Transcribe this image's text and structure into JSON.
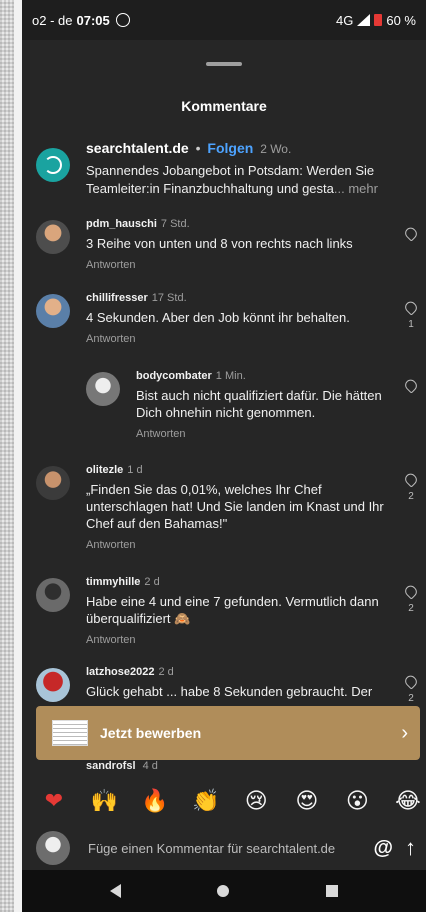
{
  "status_bar": {
    "carrier": "o2 - de",
    "time": "07:05",
    "network": "4G",
    "battery": "60 %"
  },
  "sheet": {
    "title": "Kommentare"
  },
  "caption": {
    "handle": "searchtalent.de",
    "separator": "•",
    "follow_label": "Folgen",
    "age": "2 Wo.",
    "text": "Spannendes Jobangebot in Potsdam: Werden Sie Teamleiter:in Finanzbuchhaltung und gesta",
    "more": "... mehr"
  },
  "comments": [
    {
      "user": "pdm_hauschi",
      "ago": "7 Std.",
      "text": "3 Reihe von unten und 8 von rechts nach links",
      "reply": "Antworten",
      "likes": ""
    },
    {
      "user": "chillifresser",
      "ago": "17 Std.",
      "text": "4 Sekunden. Aber den Job könnt ihr behalten.",
      "reply": "Antworten",
      "likes": "1"
    },
    {
      "user": "bodycombater",
      "ago": "1 Min.",
      "text": "Bist auch nicht qualifiziert dafür. Die hätten Dich ohnehin nicht genommen.",
      "reply": "Antworten",
      "likes": ""
    },
    {
      "user": "olitezle",
      "ago": "1 d",
      "text": "„Finden Sie das 0,01%, welches  Ihr Chef unterschlagen hat! Und Sie landen im Knast und Ihr Chef auf den Bahamas!\"",
      "reply": "Antworten",
      "likes": "2"
    },
    {
      "user": "timmyhille",
      "ago": "2 d",
      "text": "Habe eine 4 und eine 7 gefunden. Vermutlich dann überqualifiziert 🙈",
      "reply": "Antworten",
      "likes": "2"
    },
    {
      "user": "latzhose2022",
      "ago": "2 d",
      "text": "Glück gehabt ... habe 8 Sekunden gebraucht. Der",
      "reply": "",
      "likes": "2"
    }
  ],
  "apply_banner": {
    "label": "Jetzt bewerben",
    "chevron": "›"
  },
  "peek_user": {
    "user": "sandrofsl",
    "ago": "4 d"
  },
  "emoji_row": [
    "❤",
    "🙌",
    "🔥",
    "👏",
    "😢",
    "😍",
    "😮",
    "😂"
  ],
  "input": {
    "placeholder": "Füge einen Kommentar für searchtalent.de",
    "at": "@",
    "send": "↑"
  },
  "colors": {
    "background": "#262626",
    "follow": "#4da3ff",
    "apply_banner": "#b08d5a",
    "brand_avatar": "#1aa3a0"
  }
}
